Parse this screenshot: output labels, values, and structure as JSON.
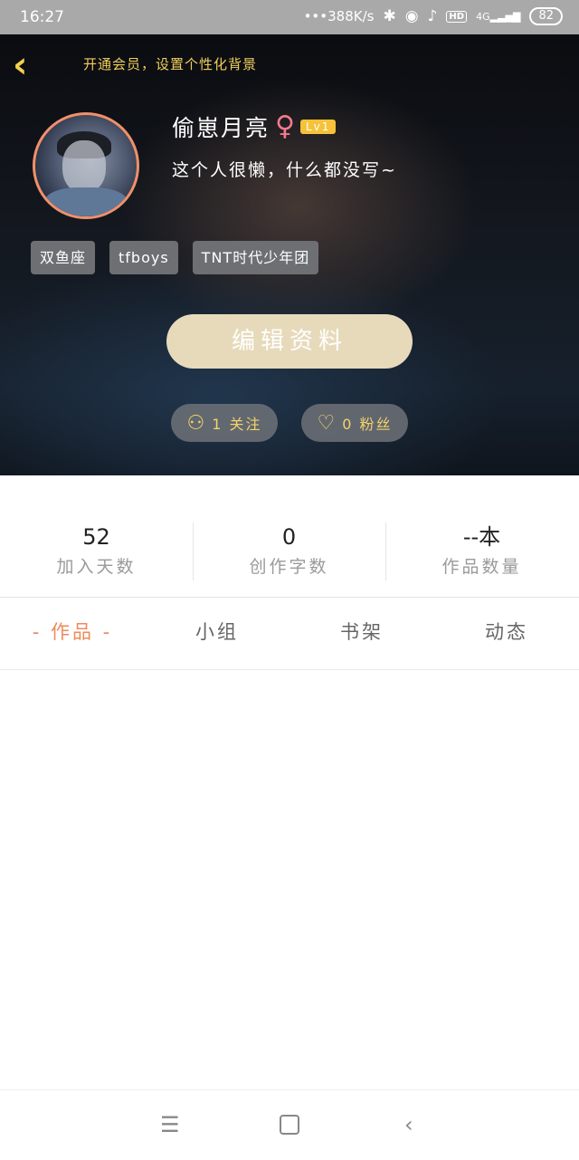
{
  "status_bar": {
    "time": "16:27",
    "net_speed": "•••388K/s",
    "signal_label": "4G",
    "hd_label": "HD",
    "battery": "82"
  },
  "header": {
    "back_icon": "chevron-left-icon",
    "vip_prompt": "开通会员，设置个性化背景"
  },
  "profile": {
    "nickname": "偷崽月亮",
    "gender_icon": "♀",
    "level": "Lv1",
    "signature": "这个人很懒，什么都没写~",
    "tags": [
      "双鱼座",
      "tfboys",
      "TNT时代少年团"
    ],
    "edit_button": "编辑资料",
    "follow_label": "1 关注",
    "fans_label": "0 粉丝"
  },
  "stats": [
    {
      "value": "52",
      "label": "加入天数"
    },
    {
      "value": "0",
      "label": "创作字数"
    },
    {
      "value": "--本",
      "label": "作品数量"
    }
  ],
  "tabs": [
    {
      "label": "- 作品 -",
      "active": true
    },
    {
      "label": "小组",
      "active": false
    },
    {
      "label": "书架",
      "active": false
    },
    {
      "label": "动态",
      "active": false
    }
  ],
  "nav": {
    "menu": "☰",
    "back": "‹"
  },
  "colors": {
    "accent": "#ee8a5c",
    "gold": "#f1cf5b",
    "edit_button": "#e7dabb"
  }
}
